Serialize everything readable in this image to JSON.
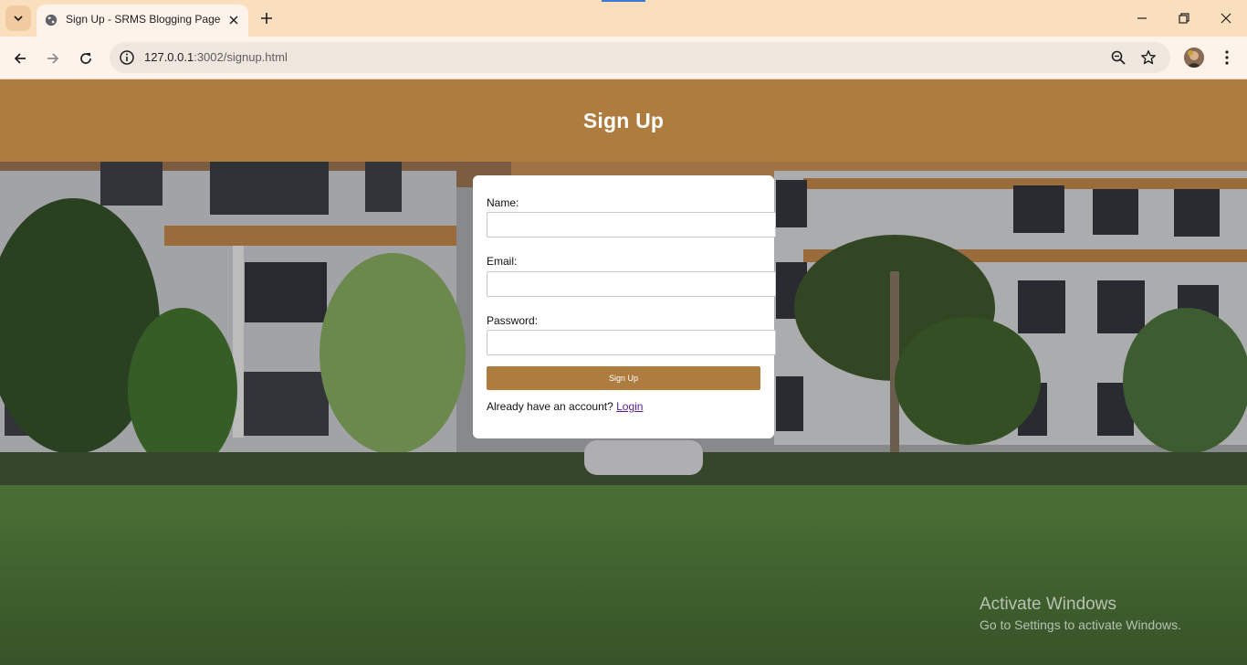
{
  "browser": {
    "tab": {
      "title": "Sign Up - SRMS Blogging Page"
    },
    "address": {
      "host": "127.0.0.1",
      "path": ":3002/signup.html"
    },
    "icons": {
      "tab_search": "chevron-down-icon",
      "favicon": "globe-icon",
      "tab_close": "close-icon",
      "new_tab": "plus-icon",
      "minimize": "minimize-icon",
      "restore": "restore-icon",
      "close": "close-icon",
      "back": "arrow-left-icon",
      "forward": "arrow-right-icon",
      "reload": "reload-icon",
      "site_info": "info-icon",
      "zoom": "zoom-icon",
      "bookmark": "star-icon",
      "profile": "avatar",
      "menu": "kebab-menu-icon"
    }
  },
  "header": {
    "title": "Sign Up"
  },
  "form": {
    "name_label": "Name:",
    "email_label": "Email:",
    "password_label": "Password:",
    "name_value": "",
    "email_value": "",
    "password_value": "",
    "submit_label": "Sign Up",
    "login_prompt": "Already have an account?",
    "login_link": "Login"
  },
  "watermark": {
    "line1": "Activate Windows",
    "line2": "Go to Settings to activate Windows."
  },
  "colors": {
    "accent": "#ad7c3e",
    "tabstrip": "#f9dfbd",
    "toolbar": "#fdf3ea"
  }
}
